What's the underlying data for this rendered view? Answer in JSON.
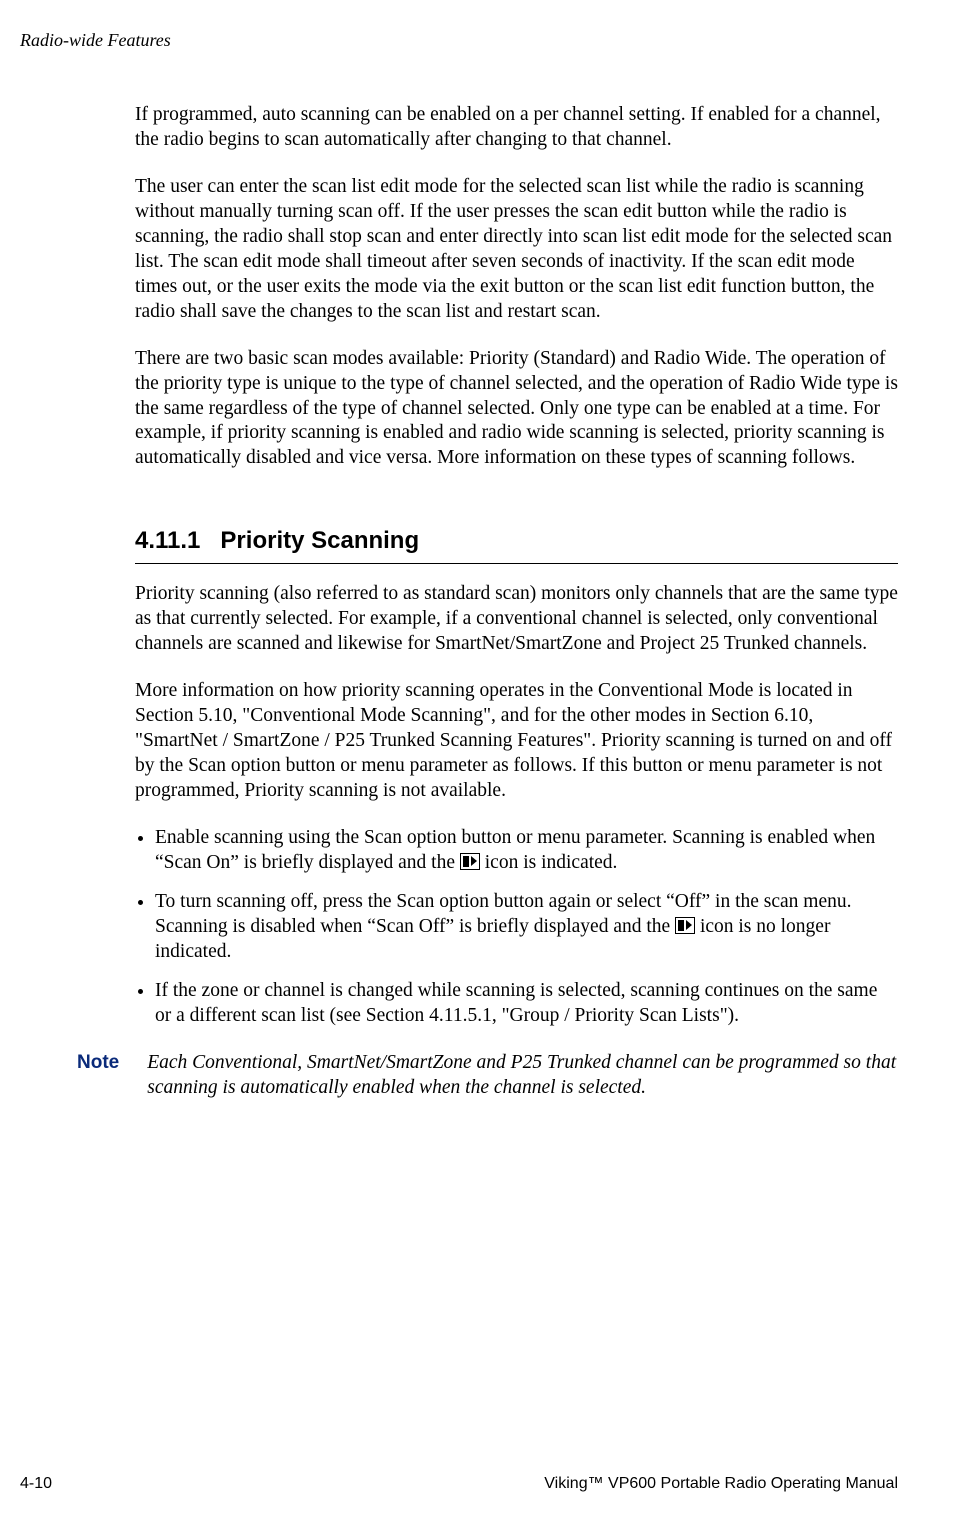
{
  "header": {
    "running": "Radio-wide Features"
  },
  "paragraphs": {
    "p1": "If programmed, auto scanning can be enabled on a per channel setting. If enabled for a channel, the radio begins to scan automatically after changing to that channel.",
    "p2": "The user can enter the scan list edit mode for the selected scan list while the radio is scanning without manually turning scan off. If the user presses the scan edit button while the radio is scanning, the radio shall stop scan and enter directly into scan list edit mode for the selected scan list. The scan edit mode shall timeout after seven seconds of inactivity. If the scan edit mode times out, or the user exits the mode via the exit button or the scan list edit function button, the radio shall save the changes to the scan list and restart scan.",
    "p3": "There are two basic scan modes available: Priority (Standard) and Radio Wide. The operation of the priority type is unique to the type of channel selected, and the operation of Radio Wide type is the same regardless of the type of channel selected. Only one type can be enabled at a time. For example, if priority scanning is enabled and radio wide scanning is selected, priority scanning is automatically disabled and vice versa. More information on these types of scanning follows."
  },
  "section": {
    "number": "4.11.1",
    "title": "Priority Scanning",
    "p1": "Priority scanning (also referred to as standard scan) monitors only channels that are the same type as that currently selected. For example, if a conventional channel is selected, only conventional channels are scanned and likewise for SmartNet/SmartZone and Project 25 Trunked channels.",
    "p2": "More information on how priority scanning operates in the Conventional Mode is located in Section 5.10, \"Conventional Mode Scanning\", and for the other modes in Section 6.10, \"SmartNet / SmartZone / P25 Trunked Scanning Features\". Priority scanning is turned on and off by the Scan option button or menu parameter as follows. If this button or menu parameter is not programmed, Priority scanning is not available.",
    "bullets": {
      "b1a": "Enable scanning using the Scan option button or menu parameter. Scanning is enabled when “Scan On” is briefly displayed and the ",
      "b1b": " icon is indicated.",
      "b2a": "To turn scanning off, press the Scan option button again or select “Off” in the scan menu. Scanning is disabled when “Scan Off” is briefly displayed and the ",
      "b2b": " icon is no longer indicated.",
      "b3": "If the zone or channel is changed while scanning is selected, scanning continues on the same or a different scan list (see Section 4.11.5.1, \"Group / Priority Scan Lists\")."
    }
  },
  "note": {
    "label": "Note",
    "text": "Each Conventional, SmartNet/SmartZone and P25 Trunked channel can be programmed so that scanning is automatically enabled when the channel is selected."
  },
  "footer": {
    "page": "4-10",
    "title": "Viking™ VP600 Portable Radio Operating Manual"
  }
}
